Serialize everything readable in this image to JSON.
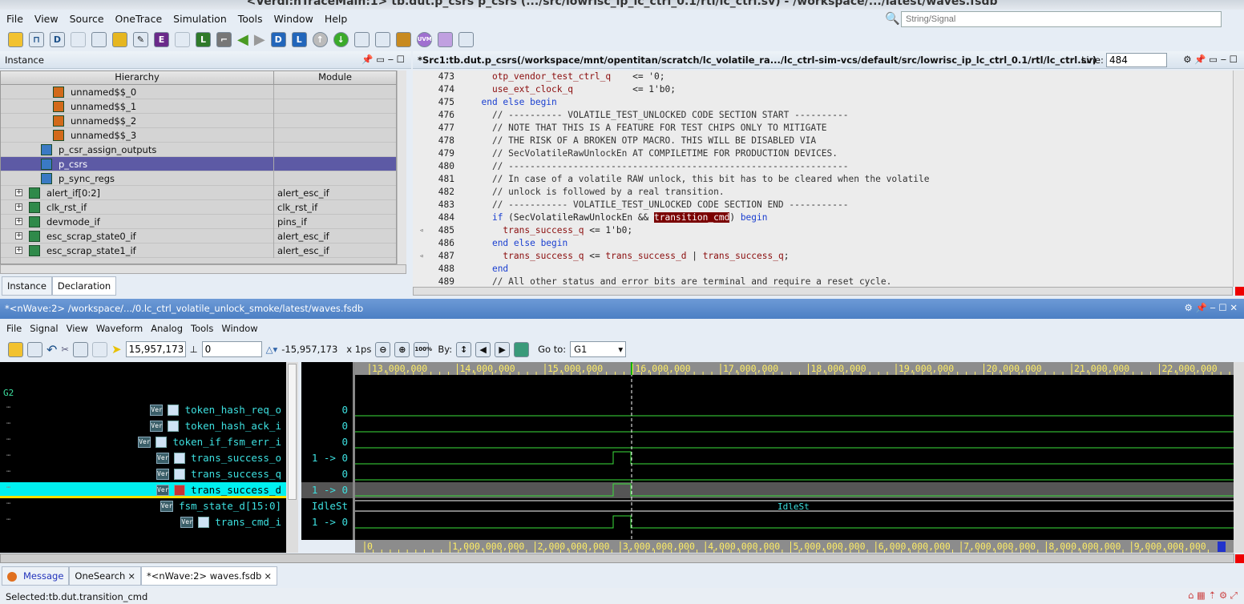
{
  "window_title": "<Verdi:nTraceMain:1> tb.dut.p_csrs p_csrs (.../src/lowrisc_ip_lc_ctrl_0.1/rtl/lc_ctrl.sv) - /workspace/.../latest/waves.fsdb",
  "menu": [
    "File",
    "View",
    "Source",
    "OneTrace",
    "Simulation",
    "Tools",
    "Window",
    "Help"
  ],
  "search_placeholder": "String/Signal",
  "instance": {
    "title": "Instance",
    "col_hierarchy": "Hierarchy",
    "col_module": "Module",
    "rows": [
      {
        "label": "unnamed$$_0",
        "module": "",
        "level": 3
      },
      {
        "label": "unnamed$$_1",
        "module": "",
        "level": 3
      },
      {
        "label": "unnamed$$_2",
        "module": "",
        "level": 3
      },
      {
        "label": "unnamed$$_3",
        "module": "",
        "level": 3
      },
      {
        "label": "p_csr_assign_outputs",
        "module": "",
        "level": 2
      },
      {
        "label": "p_csrs",
        "module": "",
        "level": 2,
        "selected": true
      },
      {
        "label": "p_sync_regs",
        "module": "",
        "level": 2
      },
      {
        "label": "alert_if[0:2]",
        "module": "alert_esc_if",
        "level": 1,
        "expander": true
      },
      {
        "label": "clk_rst_if",
        "module": "clk_rst_if",
        "level": 1,
        "expander": true
      },
      {
        "label": "devmode_if",
        "module": "pins_if",
        "level": 1,
        "expander": true
      },
      {
        "label": "esc_scrap_state0_if",
        "module": "alert_esc_if",
        "level": 1,
        "expander": true
      },
      {
        "label": "esc_scrap_state1_if",
        "module": "alert_esc_if",
        "level": 1,
        "expander": true
      }
    ],
    "tabs": [
      "Instance",
      "Declaration"
    ]
  },
  "source": {
    "title": "*Src1:tb.dut.p_csrs(/workspace/mnt/opentitan/scratch/lc_volatile_ra.../lc_ctrl-sim-vcs/default/src/lowrisc_ip_lc_ctrl_0.1/rtl/lc_ctrl.sv)",
    "line_label": "Line:",
    "line_value": "484",
    "lines": [
      {
        "n": "473",
        "s": [
          [
            "    ",
            "op"
          ],
          [
            "otp_vendor_test_ctrl_q",
            "id"
          ],
          [
            "    <= '0;",
            "op"
          ]
        ]
      },
      {
        "n": "474",
        "s": [
          [
            "    ",
            "op"
          ],
          [
            "use_ext_clock_q",
            "id"
          ],
          [
            "           <= 1'b0;",
            "op"
          ]
        ]
      },
      {
        "n": "475",
        "s": [
          [
            "  ",
            "op"
          ],
          [
            "end else begin",
            "kw"
          ]
        ]
      },
      {
        "n": "476",
        "s": [
          [
            "    // ---------- VOLATILE_TEST_UNLOCKED CODE SECTION START ----------",
            "cm"
          ]
        ]
      },
      {
        "n": "477",
        "s": [
          [
            "    // NOTE THAT THIS IS A FEATURE FOR TEST CHIPS ONLY TO MITIGATE",
            "cm"
          ]
        ]
      },
      {
        "n": "478",
        "s": [
          [
            "    // THE RISK OF A BROKEN OTP MACRO. THIS WILL BE DISABLED VIA",
            "cm"
          ]
        ]
      },
      {
        "n": "479",
        "s": [
          [
            "    // SecVolatileRawUnlockEn AT COMPILETIME FOR PRODUCTION DEVICES.",
            "cm"
          ]
        ]
      },
      {
        "n": "480",
        "s": [
          [
            "    // ---------------------------------------------------------------",
            "cm"
          ]
        ]
      },
      {
        "n": "481",
        "s": [
          [
            "    // In case of a volatile RAW unlock, this bit has to be cleared when the volatile",
            "cm"
          ]
        ]
      },
      {
        "n": "482",
        "s": [
          [
            "    // unlock is followed by a real transition.",
            "cm"
          ]
        ]
      },
      {
        "n": "483",
        "s": [
          [
            "    // ----------- VOLATILE_TEST_UNLOCKED CODE SECTION END -----------",
            "cm"
          ]
        ]
      },
      {
        "n": "484",
        "s": [
          [
            "    ",
            "op"
          ],
          [
            "if",
            "kw"
          ],
          [
            " (SecVolatileRawUnlockEn && ",
            "op"
          ],
          [
            "transition_cmd",
            "hl"
          ],
          [
            ") ",
            "op"
          ],
          [
            "begin",
            "kw"
          ]
        ]
      },
      {
        "n": "485",
        "m": true,
        "s": [
          [
            "      ",
            "op"
          ],
          [
            "trans_success_q",
            "id"
          ],
          [
            " <= 1'b0;",
            "op"
          ]
        ]
      },
      {
        "n": "486",
        "s": [
          [
            "    ",
            "op"
          ],
          [
            "end else begin",
            "kw"
          ]
        ]
      },
      {
        "n": "487",
        "m": true,
        "s": [
          [
            "      ",
            "op"
          ],
          [
            "trans_success_q",
            "id"
          ],
          [
            " <= ",
            "op"
          ],
          [
            "trans_success_d",
            "id"
          ],
          [
            " | ",
            "op"
          ],
          [
            "trans_success_q",
            "id"
          ],
          [
            ";",
            "op"
          ]
        ]
      },
      {
        "n": "488",
        "s": [
          [
            "    ",
            "op"
          ],
          [
            "end",
            "kw"
          ]
        ]
      },
      {
        "n": "489",
        "s": [
          [
            "    // All other status and error bits are terminal and require a reset cycle.",
            "cm"
          ]
        ]
      }
    ]
  },
  "nwave": {
    "title": "*<nWave:2> /workspace/.../0.lc_ctrl_volatile_unlock_smoke/latest/waves.fsdb",
    "menu": [
      "File",
      "Signal",
      "View",
      "Waveform",
      "Analog",
      "Tools",
      "Window"
    ],
    "cursor_time": "15,957,173",
    "marker_time": "0",
    "delta": "-15,957,173",
    "unit": "x 1ps",
    "by_label": "By:",
    "goto_label": "Go to:",
    "goto_value": "G1",
    "group": "G2",
    "signals": [
      {
        "name": "token_hash_req_o",
        "value": "0",
        "pulse": false
      },
      {
        "name": "token_hash_ack_i",
        "value": "0",
        "pulse": false
      },
      {
        "name": "token_if_fsm_err_i",
        "value": "0",
        "pulse": false
      },
      {
        "name": "trans_success_o",
        "value": "1 -> 0",
        "pulse": true
      },
      {
        "name": "trans_success_q",
        "value": "0",
        "pulse": false
      },
      {
        "name": "trans_success_d",
        "value": "1 -> 0",
        "pulse": true,
        "selected": true
      },
      {
        "name": "fsm_state_d[15:0]",
        "value": "IdleSt",
        "bus": "IdleSt"
      },
      {
        "name": "trans_cmd_i",
        "value": "1 -> 0",
        "pulse": true
      }
    ],
    "ruler_top": [
      "13,000,000",
      "14,000,000",
      "15,000,000",
      "16,000,000",
      "17,000,000",
      "18,000,000",
      "19,000,000",
      "20,000,000",
      "21,000,000",
      "22,000,000"
    ],
    "ruler_bottom": [
      "0",
      "1,000,000,000",
      "2,000,000,000",
      "3,000,000,000",
      "4,000,000,000",
      "5,000,000,000",
      "6,000,000,000",
      "7,000,000,000",
      "8,000,000,000",
      "9,000,000,000"
    ],
    "ver_badge": "Ver"
  },
  "bottom_tabs": [
    "Message",
    "OneSearch",
    "*<nWave:2> waves.fsdb"
  ],
  "status": "Selected:tb.dut.transition_cmd"
}
